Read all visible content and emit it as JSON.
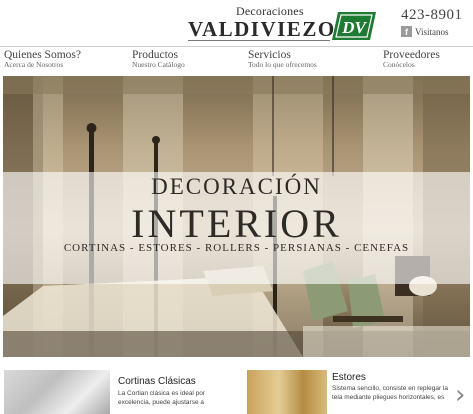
{
  "header": {
    "brand_top": "Decoraciones",
    "brand_main": "VALDIVIEZO",
    "logo_text": "DV",
    "phone": "423-8901",
    "facebook_label": "Visitanos",
    "colors": {
      "logo_green": "#1f7a33"
    }
  },
  "nav": {
    "items": [
      {
        "title": "Quienes Somos?",
        "sub": "Acerca de Nosotros"
      },
      {
        "title": "Productos",
        "sub": "Nuestro Catálogo"
      },
      {
        "title": "Servicios",
        "sub": "Todo lo que ofrecemos"
      },
      {
        "title": "Proveedores",
        "sub": "Conócelos"
      }
    ]
  },
  "hero": {
    "title_line1": "DECORACIÓN",
    "title_line2": "INTERIOR",
    "subtitle": "CORTINAS - ESTORES - ROLLERS - PERSIANAS - CENEFAS"
  },
  "cards": [
    {
      "title": "Cortinas Clásicas",
      "text": "La Cortian clásica es ideal por excelencia, puede ajustarse a"
    },
    {
      "title": "Estores",
      "text": "Sistema sencillo, consiste en replegar la tela mediante pliegues horizontales, es"
    }
  ]
}
